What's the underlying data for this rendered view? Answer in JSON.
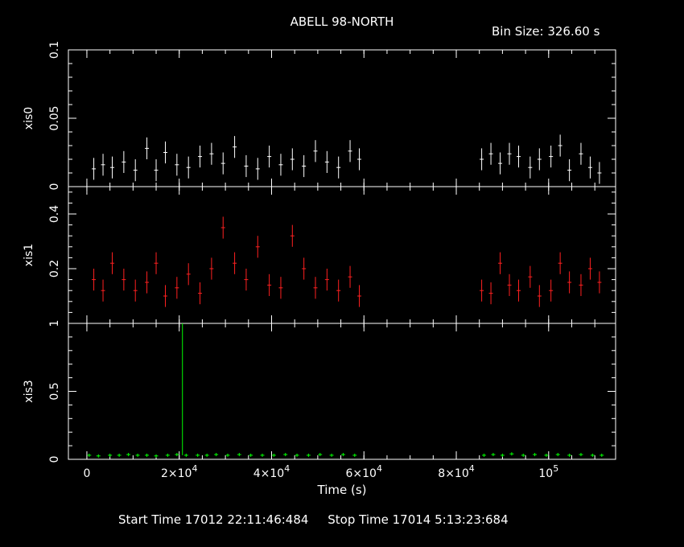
{
  "title": "ABELL 98-NORTH",
  "bin_size_label": "Bin Size: 326.60 s",
  "footer": {
    "start": "Start Time 17012 22:11:46:484",
    "stop": "Stop Time 17014  5:13:23:684"
  },
  "colors": {
    "xis0": "#ffffff",
    "xis1": "#ff2020",
    "xis3": "#00ff00",
    "background": "#000000",
    "axes": "#ffffff"
  },
  "chart_data": [
    {
      "type": "scatter",
      "panel": "xis0",
      "ylabel": "xis0",
      "xlabel": "Time (s)",
      "xlim": [
        -4000,
        114500
      ],
      "ylim": [
        0,
        0.1
      ],
      "yticks": [
        0,
        0.05,
        0.1
      ],
      "yticklabels": [
        "0",
        "0.05",
        "0.1"
      ],
      "error_bars": true,
      "series": [
        {
          "x": [
            1500,
            3500,
            5500,
            8000,
            10500,
            13000,
            15000,
            17000,
            19500,
            22000,
            24500,
            27000,
            29500,
            32000,
            34500,
            37000,
            39500,
            42000,
            44500,
            47000,
            49500,
            52000,
            54500,
            57000,
            59000,
            85500,
            87500,
            89500,
            91500,
            93500,
            96000,
            98000,
            100500,
            102500,
            104500,
            107000,
            109000,
            111000
          ],
          "y": [
            0.013,
            0.016,
            0.014,
            0.018,
            0.012,
            0.028,
            0.012,
            0.025,
            0.016,
            0.014,
            0.022,
            0.024,
            0.017,
            0.029,
            0.015,
            0.013,
            0.022,
            0.016,
            0.02,
            0.015,
            0.026,
            0.018,
            0.014,
            0.026,
            0.02,
            0.02,
            0.024,
            0.017,
            0.024,
            0.022,
            0.014,
            0.02,
            0.022,
            0.03,
            0.012,
            0.024,
            0.014,
            0.01
          ]
        }
      ]
    },
    {
      "type": "scatter",
      "panel": "xis1",
      "ylabel": "xis1",
      "xlim": [
        -4000,
        114500
      ],
      "ylim": [
        0,
        0.5
      ],
      "yticks": [
        0.2,
        0.4
      ],
      "yticklabels": [
        "0.2",
        "0.4"
      ],
      "error_bars": true,
      "series": [
        {
          "x": [
            1500,
            3500,
            5500,
            8000,
            10500,
            13000,
            15000,
            17000,
            19500,
            22000,
            24500,
            27000,
            29500,
            32000,
            34500,
            37000,
            39500,
            42000,
            44500,
            47000,
            49500,
            52000,
            54500,
            57000,
            59000,
            85500,
            87500,
            89500,
            91500,
            93500,
            96000,
            98000,
            100500,
            102500,
            104500,
            107000,
            109000,
            111000
          ],
          "y": [
            0.16,
            0.12,
            0.22,
            0.16,
            0.12,
            0.15,
            0.22,
            0.1,
            0.13,
            0.18,
            0.11,
            0.2,
            0.35,
            0.22,
            0.16,
            0.28,
            0.14,
            0.13,
            0.32,
            0.2,
            0.13,
            0.16,
            0.12,
            0.17,
            0.1,
            0.12,
            0.11,
            0.22,
            0.14,
            0.12,
            0.17,
            0.1,
            0.12,
            0.22,
            0.15,
            0.14,
            0.2,
            0.15
          ]
        }
      ]
    },
    {
      "type": "scatter",
      "panel": "xis3",
      "ylabel": "xis3",
      "xlim": [
        -4000,
        114500
      ],
      "ylim": [
        0,
        1
      ],
      "yticks": [
        0,
        0.5,
        1
      ],
      "yticklabels": [
        "0",
        "0.5",
        "1"
      ],
      "error_bars": true,
      "spike": {
        "x": 20700,
        "y": 1.0
      },
      "series": [
        {
          "x": [
            500,
            2500,
            5000,
            7000,
            9000,
            11000,
            13000,
            15000,
            17500,
            19500,
            21500,
            24000,
            26000,
            28000,
            30500,
            33000,
            35500,
            38000,
            40500,
            43000,
            45500,
            48000,
            50500,
            53000,
            55500,
            58000,
            86000,
            88000,
            90000,
            92000,
            94500,
            97000,
            99500,
            102000,
            104500,
            107000,
            109500,
            111500
          ],
          "y": [
            0.03,
            0.025,
            0.03,
            0.03,
            0.035,
            0.03,
            0.03,
            0.025,
            0.03,
            0.035,
            0.03,
            0.03,
            0.03,
            0.035,
            0.03,
            0.035,
            0.03,
            0.03,
            0.03,
            0.035,
            0.03,
            0.03,
            0.035,
            0.03,
            0.035,
            0.03,
            0.03,
            0.035,
            0.03,
            0.04,
            0.03,
            0.035,
            0.03,
            0.035,
            0.03,
            0.035,
            0.03,
            0.03
          ]
        }
      ]
    }
  ],
  "x_axis": {
    "label": "Time (s)",
    "ticks": [
      0,
      20000,
      40000,
      60000,
      80000,
      100000
    ],
    "tick_labels": [
      {
        "mant": "0",
        "exp": ""
      },
      {
        "mant": "2×10",
        "exp": "4"
      },
      {
        "mant": "4×10",
        "exp": "4"
      },
      {
        "mant": "6×10",
        "exp": "4"
      },
      {
        "mant": "8×10",
        "exp": "4"
      },
      {
        "mant": "10",
        "exp": "5"
      }
    ]
  }
}
